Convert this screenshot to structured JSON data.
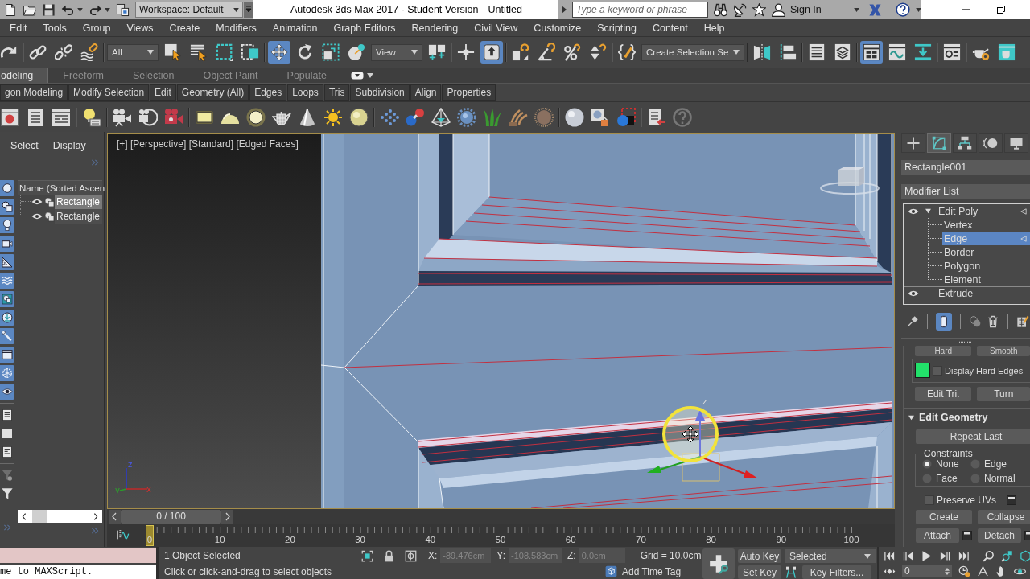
{
  "title_bar": {
    "workspace": "Workspace: Default",
    "app_title": "Autodesk 3ds Max 2017 - Student Version",
    "document": "Untitled",
    "search": {
      "placeholder": "Type a keyword or phrase"
    },
    "sign_in": "Sign In"
  },
  "menu_bar": [
    "Edit",
    "Tools",
    "Group",
    "Views",
    "Create",
    "Modifiers",
    "Animation",
    "Graph Editors",
    "Rendering",
    "Civil View",
    "Customize",
    "Scripting",
    "Content",
    "Help"
  ],
  "main_toolbar": [
    {
      "kind": "button",
      "selected": false
    },
    {
      "kind": "separator"
    },
    {
      "kind": "button",
      "selected": false
    },
    {
      "kind": "button",
      "selected": false
    },
    {
      "kind": "button",
      "selected": false
    },
    {
      "kind": "separator"
    },
    {
      "kind": "dropdown",
      "value": "All"
    },
    {
      "kind": "button",
      "selected": false
    },
    {
      "kind": "button",
      "selected": false
    },
    {
      "kind": "button",
      "selected": false
    },
    {
      "kind": "button",
      "selected": false
    },
    {
      "kind": "separator"
    },
    {
      "kind": "button",
      "selected": true
    },
    {
      "kind": "button",
      "selected": false
    },
    {
      "kind": "button",
      "selected": false
    },
    {
      "kind": "button",
      "selected": false
    },
    {
      "kind": "dropdown",
      "value": "View"
    },
    {
      "kind": "button",
      "selected": false
    },
    {
      "kind": "separator"
    },
    {
      "kind": "button",
      "selected": false
    },
    {
      "kind": "button",
      "selected": true
    },
    {
      "kind": "separator"
    },
    {
      "kind": "button",
      "selected": false
    },
    {
      "kind": "button",
      "selected": false
    },
    {
      "kind": "button",
      "selected": false
    },
    {
      "kind": "button",
      "selected": false
    },
    {
      "kind": "separator"
    },
    {
      "kind": "button",
      "selected": false
    },
    {
      "kind": "dropdown",
      "value": "Create Selection Se"
    },
    {
      "kind": "separator"
    },
    {
      "kind": "button",
      "selected": false
    },
    {
      "kind": "button",
      "selected": false
    },
    {
      "kind": "separator"
    },
    {
      "kind": "button",
      "selected": false
    },
    {
      "kind": "button",
      "selected": false
    },
    {
      "kind": "separator"
    },
    {
      "kind": "button",
      "selected": true
    },
    {
      "kind": "button",
      "selected": false
    },
    {
      "kind": "button",
      "selected": false
    },
    {
      "kind": "separator"
    },
    {
      "kind": "button",
      "selected": false
    },
    {
      "kind": "separator"
    },
    {
      "kind": "button",
      "selected": false
    },
    {
      "kind": "button",
      "selected": false
    }
  ],
  "ribbon": {
    "tabs": [
      {
        "label": "odeling",
        "selected": true
      },
      {
        "label": "Freeform",
        "selected": false
      },
      {
        "label": "Selection",
        "selected": false
      },
      {
        "label": "Object Paint",
        "selected": false
      },
      {
        "label": "Populate",
        "selected": false
      }
    ],
    "panels": [
      "gon Modeling",
      "Modify Selection",
      "Edit",
      "Geometry (All)",
      "Edges",
      "Loops",
      "Tris",
      "Subdivision",
      "Align",
      "Properties"
    ]
  },
  "scene_explorer": {
    "tabs": [
      "Select",
      "Display"
    ],
    "filters": [
      {
        "on": true
      },
      {
        "on": true
      },
      {
        "on": true
      },
      {
        "on": true
      },
      {
        "on": true
      },
      {
        "on": true
      },
      {
        "on": true
      },
      {
        "on": true
      },
      {
        "on": true
      },
      {
        "on": true
      },
      {
        "on": true
      },
      {
        "on": true
      }
    ],
    "column": "Name (Sorted Ascen",
    "rows": [
      {
        "name": "Rectangle",
        "selected": true
      },
      {
        "name": "Rectangle",
        "selected": false
      }
    ]
  },
  "viewport": {
    "label": "[+] [Perspective] [Standard] [Edged Faces]",
    "active": true,
    "axis_tripod": [
      "z",
      "y",
      "x"
    ],
    "gizmo_axis": "z"
  },
  "time_slider": {
    "label": "0 / 100"
  },
  "track_bar": {
    "frames": [
      "0",
      "10",
      "20",
      "30",
      "40",
      "50",
      "60",
      "70",
      "80",
      "90",
      "100"
    ]
  },
  "command_panel": {
    "tabs": [
      {
        "selected": false
      },
      {
        "selected": true
      },
      {
        "selected": false
      },
      {
        "selected": false
      },
      {
        "selected": false
      }
    ],
    "object_name": "Rectangle001",
    "modifier_list": "Modifier List",
    "stack": [
      {
        "name": "Edit Poly",
        "enabled": true,
        "selected": false,
        "expanded": true,
        "children": [
          {
            "name": "Vertex",
            "selected": false
          },
          {
            "name": "Edge",
            "selected": true
          },
          {
            "name": "Border",
            "selected": false
          },
          {
            "name": "Polygon",
            "selected": false
          },
          {
            "name": "Element",
            "selected": false
          }
        ]
      },
      {
        "name": "Extrude",
        "enabled": true,
        "selected": false
      }
    ],
    "stack_tools": [
      {
        "selected": false
      },
      {
        "selected": true
      },
      {
        "selected": false
      },
      {
        "selected": false
      },
      {
        "selected": false
      }
    ],
    "smoothing": {
      "buttons": [
        "Hard",
        "Smooth"
      ],
      "swatch": {
        "color": "#22e06a"
      },
      "display_hard_edges": {
        "label": "Display Hard Edges",
        "checked": false
      },
      "actions": [
        "Edit Tri.",
        "Turn"
      ]
    },
    "edit_geometry": {
      "title": "Edit Geometry",
      "expanded": true,
      "repeat": "Repeat Last",
      "constraints": {
        "label": "Constraints",
        "options": [
          {
            "label": "None",
            "selected": true
          },
          {
            "label": "Edge",
            "selected": false
          },
          {
            "label": "Face",
            "selected": false
          },
          {
            "label": "Normal",
            "selected": false
          }
        ]
      },
      "preserve_uvs": {
        "label": "Preserve UVs",
        "checked": false
      },
      "buttons": [
        {
          "label": "Create",
          "settings": false
        },
        {
          "label": "Collapse",
          "settings": false
        },
        {
          "label": "Attach",
          "settings": true
        },
        {
          "label": "Detach",
          "settings": true
        }
      ]
    }
  },
  "maxscript": {
    "output": "me to MAXScript."
  },
  "status_bar": {
    "selection": "1 Object Selected",
    "prompt": "Click or click-and-drag to select objects",
    "coordinates": [
      {
        "axis": "X:",
        "value": "-89.476cm",
        "disabled": true
      },
      {
        "axis": "Y:",
        "value": "-108.583cm",
        "disabled": true
      },
      {
        "axis": "Z:",
        "value": "0.0cm",
        "disabled": true
      }
    ],
    "grid": "Grid = 10.0cm",
    "time_tag": "Add Time Tag"
  },
  "animation": {
    "auto_key": {
      "label": "Auto Key",
      "on": false
    },
    "key_mode": "Selected",
    "set_key": "Set Key",
    "key_filters": "Key Filters...",
    "frame": "0"
  }
}
